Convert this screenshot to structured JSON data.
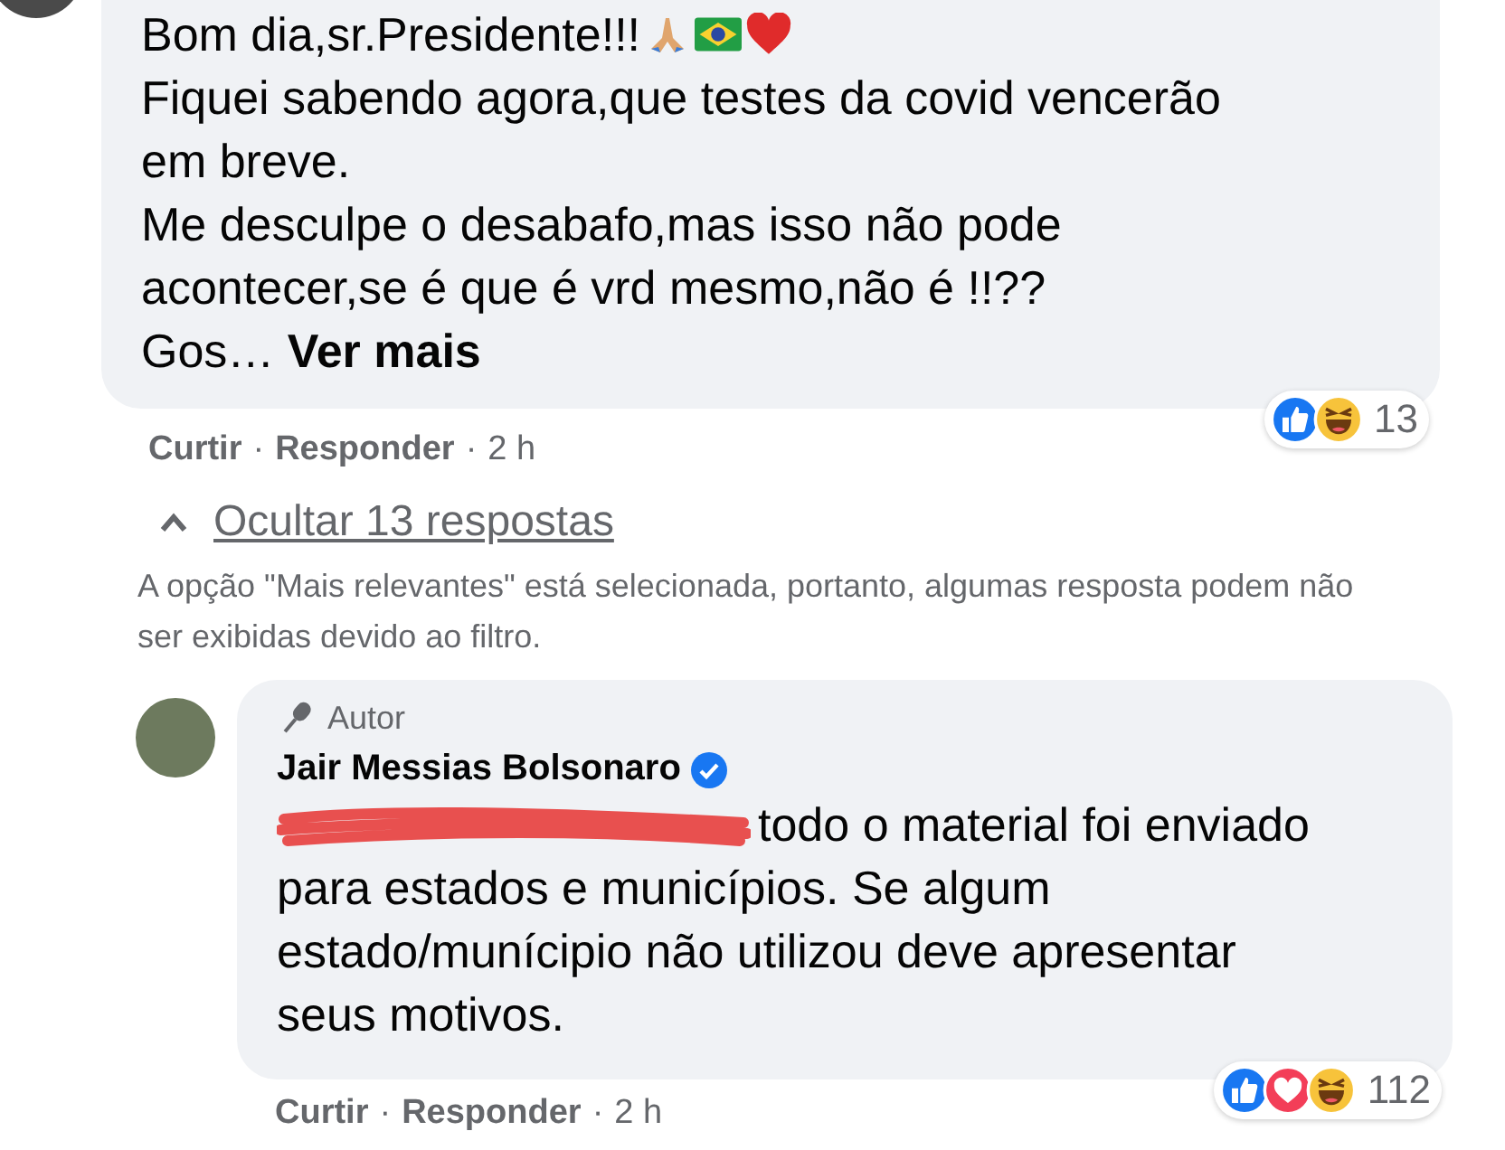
{
  "comment": {
    "paragraphs": [
      {
        "text": "Bom dia,sr.Presidente!!!",
        "emojis": [
          {
            "kind": "pray"
          },
          {
            "kind": "flag"
          },
          {
            "kind": "heart"
          }
        ]
      },
      {
        "text": "Fiquei sabendo agora,que testes da covid vencerão em breve."
      },
      {
        "text": "Me desculpe o desabafo,mas isso não pode acontecer,se é que é vrd mesmo,não é !!??"
      },
      {
        "text": "Gos…",
        "see_more": "Ver mais"
      }
    ],
    "reactions": [
      {
        "kind": "like"
      },
      {
        "kind": "haha"
      }
    ],
    "reaction_count": "13",
    "actions": [
      "Curtir",
      "Responder"
    ],
    "separator": "·",
    "time": "2 h"
  },
  "replies_toggle": {
    "label": "Ocultar 13 respostas",
    "expanded": true
  },
  "filter_notice": "A opção \"Mais relevantes\" está selecionada, portanto, algumas resposta podem não ser exibidas devido ao filtro.",
  "reply": {
    "badge": "Autor",
    "author": "Jair Messias Bolsonaro",
    "verified": true,
    "redacted": true,
    "text": "todo o material foi enviado para estados e municípios. Se algum estado/munícipio não utilizou deve apresentar seus motivos.",
    "reactions": [
      {
        "kind": "like"
      },
      {
        "kind": "love"
      },
      {
        "kind": "haha"
      }
    ],
    "reaction_count": "112",
    "actions": [
      "Curtir",
      "Responder"
    ],
    "separator": "·",
    "time": "2 h"
  }
}
